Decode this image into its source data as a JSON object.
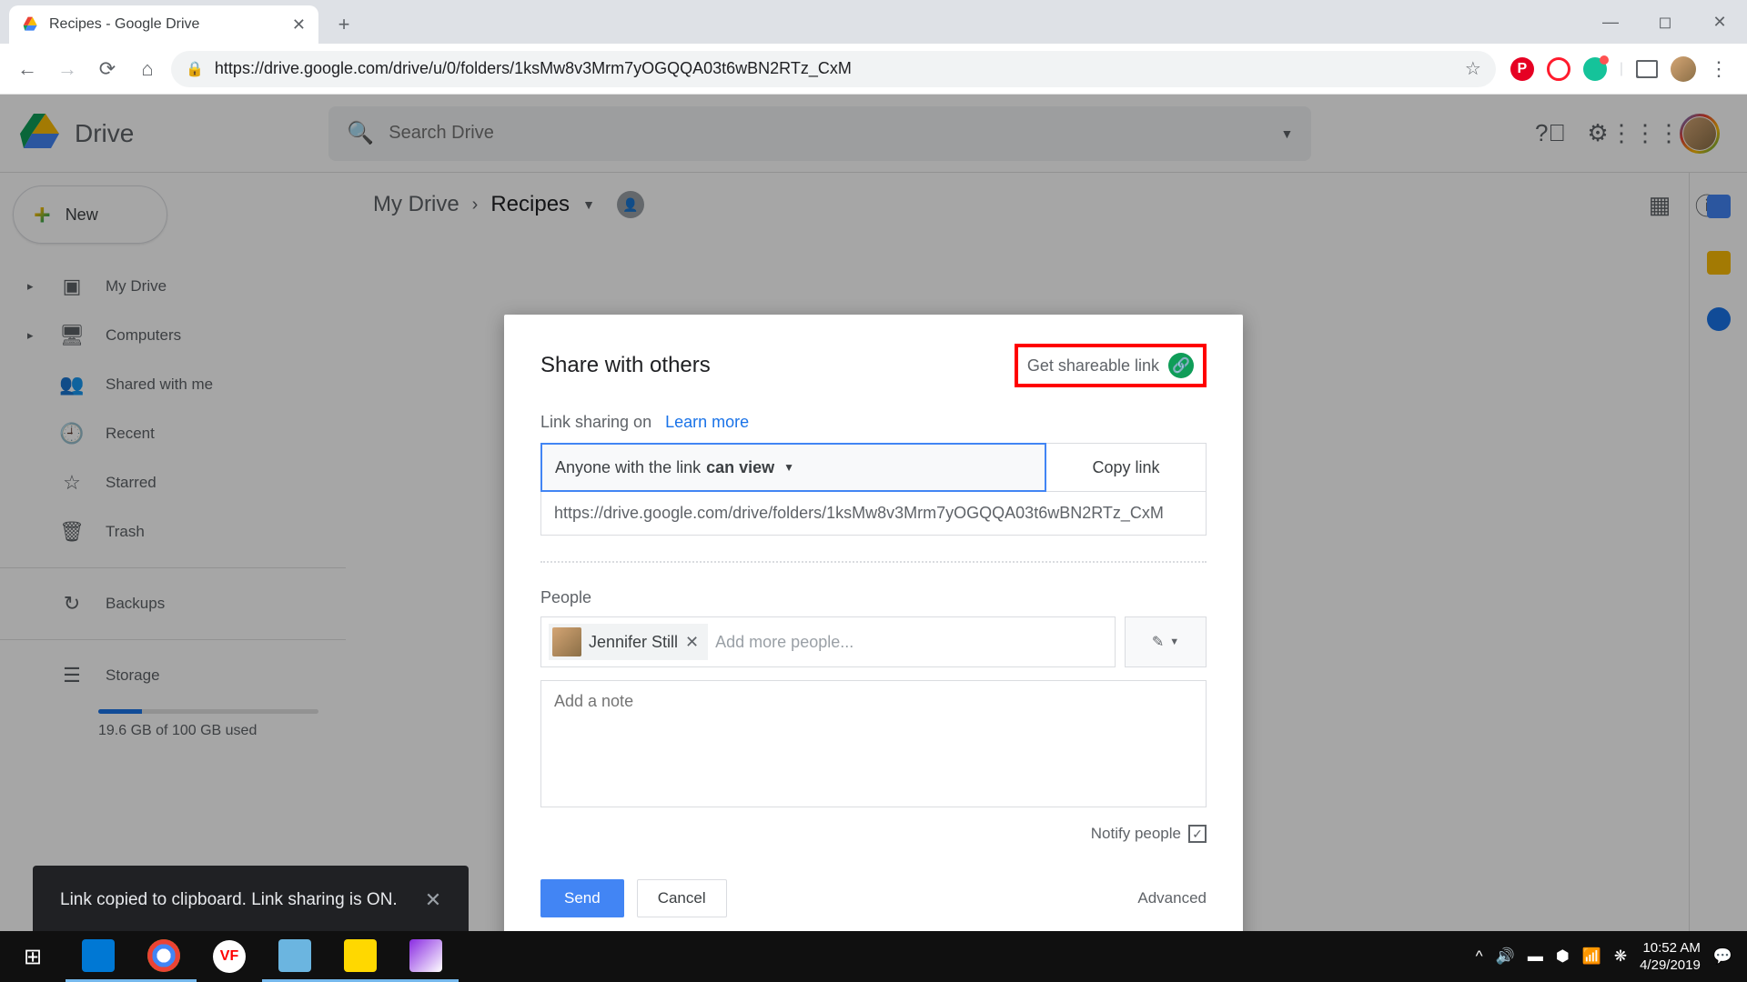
{
  "browser": {
    "tab_title": "Recipes - Google Drive",
    "url": "https://drive.google.com/drive/u/0/folders/1ksMw8v3Mrm7yOGQQA03t6wBN2RTz_CxM"
  },
  "drive": {
    "app_name": "Drive",
    "search_placeholder": "Search Drive",
    "new_button": "New",
    "nav": {
      "my_drive": "My Drive",
      "computers": "Computers",
      "shared": "Shared with me",
      "recent": "Recent",
      "starred": "Starred",
      "trash": "Trash",
      "backups": "Backups",
      "storage": "Storage",
      "storage_used": "19.6 GB of 100 GB used"
    },
    "breadcrumb": {
      "root": "My Drive",
      "current": "Recipes"
    }
  },
  "dialog": {
    "title": "Share with others",
    "get_link": "Get shareable link",
    "link_sharing": "Link sharing on",
    "learn_more": "Learn more",
    "permission_prefix": "Anyone with the link ",
    "permission_level": "can view",
    "copy_link": "Copy link",
    "link_url": "https://drive.google.com/drive/folders/1ksMw8v3Mrm7yOGQQA03t6wBN2RTz_CxM",
    "people_label": "People",
    "chip_name": "Jennifer Still",
    "people_placeholder": "Add more people...",
    "note_placeholder": "Add a note",
    "notify": "Notify people",
    "send": "Send",
    "cancel": "Cancel",
    "advanced": "Advanced"
  },
  "toast": {
    "message": "Link copied to clipboard. Link sharing is ON."
  },
  "taskbar": {
    "time": "10:52 AM",
    "date": "4/29/2019",
    "vf": "VF"
  }
}
